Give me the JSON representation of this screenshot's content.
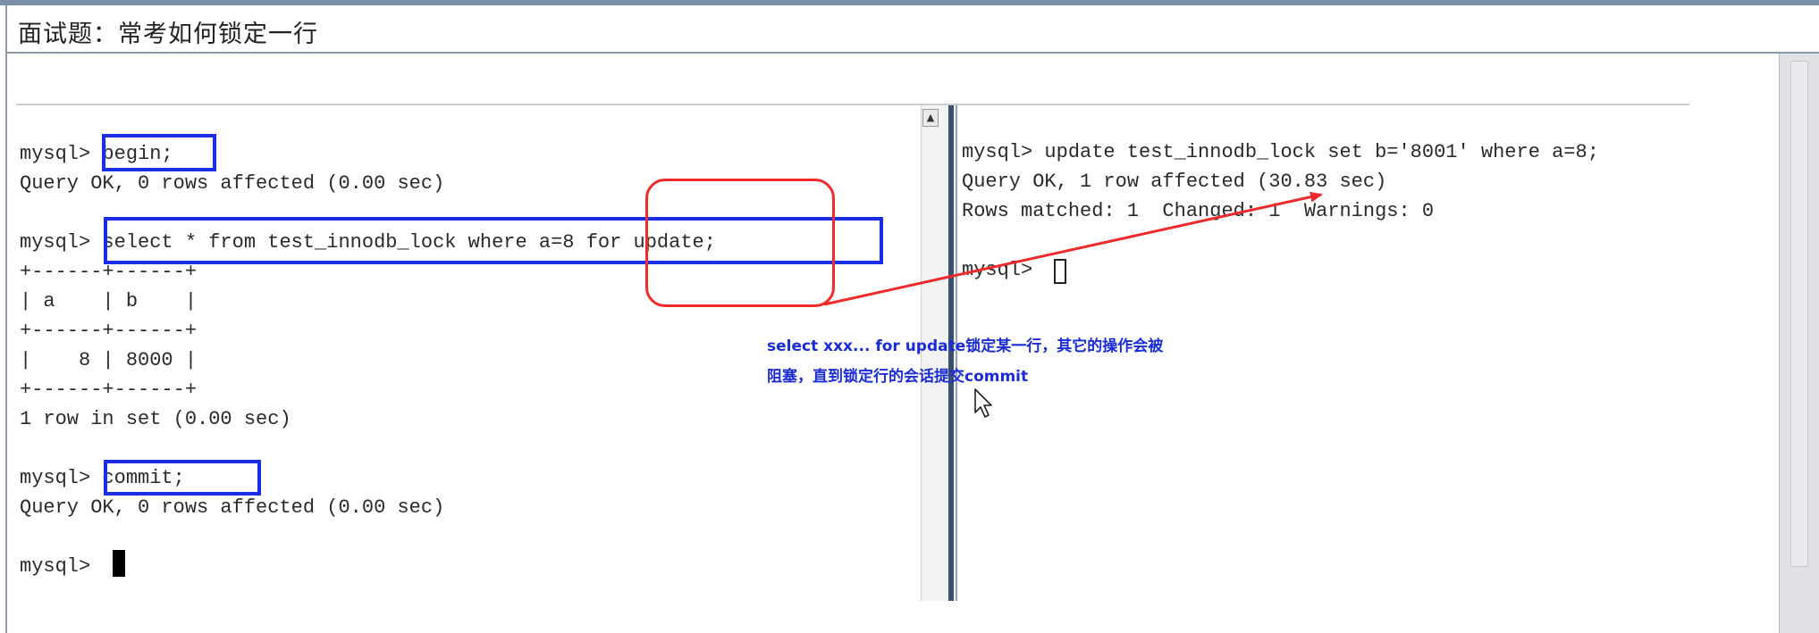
{
  "window": {
    "title": "面试题：常考如何锁定一行"
  },
  "left_terminal": {
    "lines": [
      "mysql> begin;",
      "Query OK, 0 rows affected (0.00 sec)",
      "",
      "mysql> select * from test_innodb_lock where a=8 for update;",
      "+------+------+",
      "| a    | b    |",
      "+------+------+",
      "|    8 | 8000 |",
      "+------+------+",
      "1 row in set (0.00 sec)",
      "",
      "mysql> commit;",
      "Query OK, 0 rows affected (0.00 sec)",
      "",
      "mysql> "
    ]
  },
  "right_terminal": {
    "lines": [
      "mysql> update test_innodb_lock set b='8001' where a=8;",
      "Query OK, 1 row affected (30.83 sec)",
      "Rows matched: 1  Changed: 1  Warnings: 0",
      "",
      "mysql> "
    ]
  },
  "annotation": {
    "line1": "select xxx... for update锁定某一行，其它的操作会被",
    "line2": "阻塞，直到锁定行的会话提交commit"
  },
  "icons": {
    "scroll_up": "scroll-up-arrow-icon",
    "mouse_cursor": "mouse-pointer-icon"
  },
  "colors": {
    "highlight_box": "#1a2ee6",
    "arrow": "#ee2a2a",
    "annotation_text": "#1a2cd8"
  }
}
